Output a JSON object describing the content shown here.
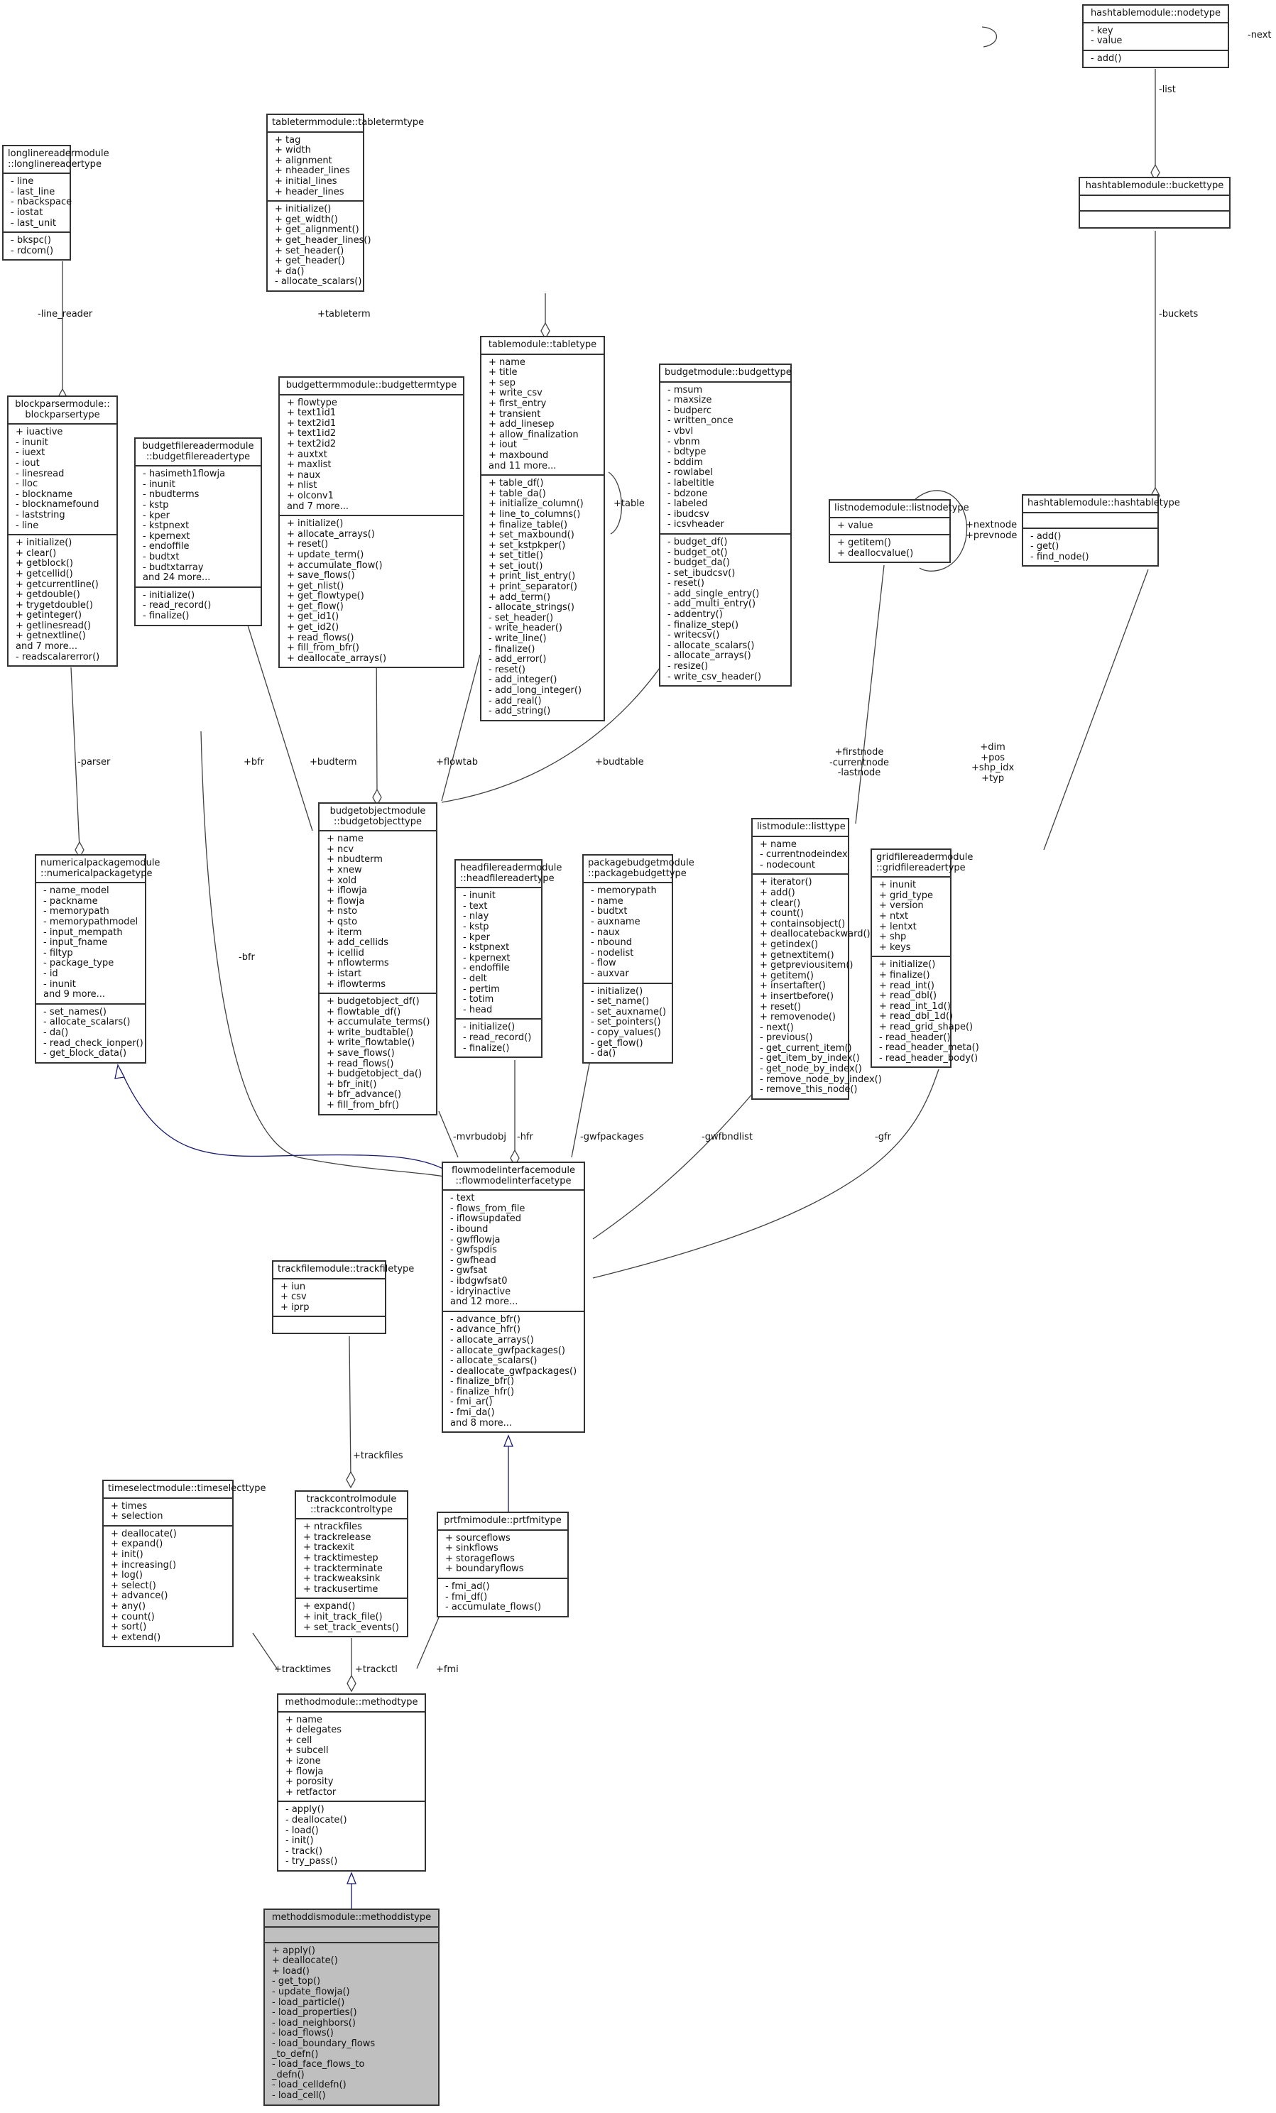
{
  "diagram": {
    "type": "uml-collaboration-graph",
    "focus_class": "methoddismodule::methoddistype",
    "colors": {
      "edge": "#404040",
      "inheritance": "#191970",
      "focus_fill": "#bfbfbf",
      "box_border": "#333333"
    }
  },
  "classes": {
    "nodetype": {
      "title": "hashtablemodule::nodetype",
      "attributes": [
        "- key",
        "- value"
      ],
      "methods": [
        "- add()"
      ]
    },
    "buckettype": {
      "title": "hashtablemodule::buckettype",
      "attributes": [],
      "methods": []
    },
    "hashtabletype": {
      "title": "hashtablemodule::hashtabletype",
      "attributes": [],
      "methods": [
        "- add()",
        "- get()",
        "- find_node()"
      ]
    },
    "longlinereadertype": {
      "title": "longlinereadermodule\n::longlinereadertype",
      "attributes": [
        "- line",
        "- last_line",
        "- nbackspace",
        "- iostat",
        "- last_unit"
      ],
      "methods": [
        "- bkspc()",
        "- rdcom()"
      ]
    },
    "tabletermtype": {
      "title": "tabletermmodule::tabletermtype",
      "attributes": [
        "+ tag",
        "+ width",
        "+ alignment",
        "+ nheader_lines",
        "+ initial_lines",
        "+ header_lines"
      ],
      "methods": [
        "+ initialize()",
        "+ get_width()",
        "+ get_alignment()",
        "+ get_header_lines()",
        "+ set_header()",
        "+ get_header()",
        "+ da()",
        "- allocate_scalars()"
      ]
    },
    "blockparsertype": {
      "title": "blockparsermodule::\nblockparsertype",
      "attributes": [
        "+ iuactive",
        "- inunit",
        "- iuext",
        "- iout",
        "- linesread",
        "- lloc",
        "- blockname",
        "- blocknamefound",
        "- laststring",
        "- line"
      ],
      "methods": [
        "+ initialize()",
        "+ clear()",
        "+ getblock()",
        "+ getcellid()",
        "+ getcurrentline()",
        "+ getdouble()",
        "+ trygetdouble()",
        "+ getinteger()",
        "+ getlinesread()",
        "+ getnextline()",
        "and 7 more...",
        "- readscalarerror()"
      ]
    },
    "budgetfilereadertype": {
      "title": "budgetfilereadermodule\n::budgetfilereadertype",
      "attributes": [
        "- hasimeth1flowja",
        "- inunit",
        "- nbudterms",
        "- kstp",
        "- kper",
        "- kstpnext",
        "- kpernext",
        "- endoffile",
        "- budtxt",
        "- budtxtarray",
        "and 24 more..."
      ],
      "methods": [
        "- initialize()",
        "- read_record()",
        "- finalize()"
      ]
    },
    "budgettermtype": {
      "title": "budgettermmodule::budgettermtype",
      "attributes": [
        "+ flowtype",
        "+ text1id1",
        "+ text2id1",
        "+ text1id2",
        "+ text2id2",
        "+ auxtxt",
        "+ maxlist",
        "+ naux",
        "+ nlist",
        "+ olconv1",
        "and 7 more..."
      ],
      "methods": [
        "+ initialize()",
        "+ allocate_arrays()",
        "+ reset()",
        "+ update_term()",
        "+ accumulate_flow()",
        "+ save_flows()",
        "+ get_nlist()",
        "+ get_flowtype()",
        "+ get_flow()",
        "+ get_id1()",
        "+ get_id2()",
        "+ read_flows()",
        "+ fill_from_bfr()",
        "+ deallocate_arrays()"
      ]
    },
    "tabletype": {
      "title": "tablemodule::tabletype",
      "attributes": [
        "+ name",
        "+ title",
        "+ sep",
        "+ write_csv",
        "+ first_entry",
        "+ transient",
        "+ add_linesep",
        "+ allow_finalization",
        "+ iout",
        "+ maxbound",
        "and 11 more..."
      ],
      "methods": [
        "+ table_df()",
        "+ table_da()",
        "+ initialize_column()",
        "+ line_to_columns()",
        "+ finalize_table()",
        "+ set_maxbound()",
        "+ set_kstpkper()",
        "+ set_title()",
        "+ set_iout()",
        "+ print_list_entry()",
        "+ print_separator()",
        "+ add_term()",
        "- allocate_strings()",
        "- set_header()",
        "- write_header()",
        "- write_line()",
        "- finalize()",
        "- add_error()",
        "- reset()",
        "- add_integer()",
        "- add_long_integer()",
        "- add_real()",
        "- add_string()"
      ]
    },
    "budgettype": {
      "title": "budgetmodule::budgettype",
      "attributes": [
        "- msum",
        "- maxsize",
        "- budperc",
        "- written_once",
        "- vbvl",
        "- vbnm",
        "- bdtype",
        "- bddim",
        "- rowlabel",
        "- labeltitle",
        "- bdzone",
        "- labeled",
        "- ibudcsv",
        "- icsvheader"
      ],
      "methods": [
        "- budget_df()",
        "- budget_ot()",
        "- budget_da()",
        "- set_ibudcsv()",
        "- reset()",
        "- add_single_entry()",
        "- add_multi_entry()",
        "- addentry()",
        "- finalize_step()",
        "- writecsv()",
        "- allocate_scalars()",
        "- allocate_arrays()",
        "- resize()",
        "- write_csv_header()"
      ]
    },
    "listnodetype": {
      "title": "listnodemodule::listnodetype",
      "attributes": [
        "+ value"
      ],
      "methods": [
        "+ getitem()",
        "+ deallocvalue()"
      ]
    },
    "numericalpackagetype": {
      "title": "numericalpackagemodule\n::numericalpackagetype",
      "attributes": [
        "- name_model",
        "- packname",
        "- memorypath",
        "- memorypathmodel",
        "- input_mempath",
        "- input_fname",
        "- filtyp",
        "- package_type",
        "- id",
        "- inunit",
        "and 9 more..."
      ],
      "methods": [
        "- set_names()",
        "- allocate_scalars()",
        "- da()",
        "- read_check_ionper()",
        "- get_block_data()"
      ]
    },
    "budgetobjecttype": {
      "title": "budgetobjectmodule\n::budgetobjecttype",
      "attributes": [
        "+ name",
        "+ ncv",
        "+ nbudterm",
        "+ xnew",
        "+ xold",
        "+ iflowja",
        "+ flowja",
        "+ nsto",
        "+ qsto",
        "+ iterm",
        "+ add_cellids",
        "+ icellid",
        "+ nflowterms",
        "+ istart",
        "+ iflowterms"
      ],
      "methods": [
        "+ budgetobject_df()",
        "+ flowtable_df()",
        "+ accumulate_terms()",
        "+ write_budtable()",
        "+ write_flowtable()",
        "+ save_flows()",
        "+ read_flows()",
        "+ budgetobject_da()",
        "+ bfr_init()",
        "+ bfr_advance()",
        "+ fill_from_bfr()"
      ]
    },
    "headfilereadertype": {
      "title": "headfilereadermodule\n::headfilereadertype",
      "attributes": [
        "- inunit",
        "- text",
        "- nlay",
        "- kstp",
        "- kper",
        "- kstpnext",
        "- kpernext",
        "- endoffile",
        "- delt",
        "- pertim",
        "- totim",
        "- head"
      ],
      "methods": [
        "- initialize()",
        "- read_record()",
        "- finalize()"
      ]
    },
    "packagebudgettype": {
      "title": "packagebudgetmodule\n::packagebudgettype",
      "attributes": [
        "- memorypath",
        "- name",
        "- budtxt",
        "- auxname",
        "- naux",
        "- nbound",
        "- nodelist",
        "- flow",
        "- auxvar"
      ],
      "methods": [
        "- initialize()",
        "- set_name()",
        "- set_auxname()",
        "- set_pointers()",
        "- copy_values()",
        "- get_flow()",
        "- da()"
      ]
    },
    "listtype": {
      "title": "listmodule::listtype",
      "attributes": [
        "+ name",
        "- currentnodeindex",
        "- nodecount"
      ],
      "methods": [
        "+ iterator()",
        "+ add()",
        "+ clear()",
        "+ count()",
        "+ containsobject()",
        "+ deallocatebackward()",
        "+ getindex()",
        "+ getnextitem()",
        "+ getpreviousitem()",
        "+ getitem()",
        "+ insertafter()",
        "+ insertbefore()",
        "+ reset()",
        "+ removenode()",
        "- next()",
        "- previous()",
        "- get_current_item()",
        "- get_item_by_index()",
        "- get_node_by_index()",
        "- remove_node_by_index()",
        "- remove_this_node()"
      ]
    },
    "gridfilereadertype": {
      "title": "gridfilereadermodule\n::gridfilereadertype",
      "attributes": [
        "+ inunit",
        "+ grid_type",
        "+ version",
        "+ ntxt",
        "+ lentxt",
        "+ shp",
        "+ keys"
      ],
      "methods": [
        "+ initialize()",
        "+ finalize()",
        "+ read_int()",
        "+ read_dbl()",
        "+ read_int_1d()",
        "+ read_dbl_1d()",
        "+ read_grid_shape()",
        "- read_header()",
        "- read_header_meta()",
        "- read_header_body()"
      ]
    },
    "flowmodelinterfacetype": {
      "title": "flowmodelinterfacemodule\n::flowmodelinterfacetype",
      "attributes": [
        "- text",
        "- flows_from_file",
        "- iflowsupdated",
        "- ibound",
        "- gwfflowja",
        "- gwfspdis",
        "- gwfhead",
        "- gwfsat",
        "- ibdgwfsat0",
        "- idryinactive",
        "and 12 more..."
      ],
      "methods": [
        "- advance_bfr()",
        "- advance_hfr()",
        "- allocate_arrays()",
        "- allocate_gwfpackages()",
        "- allocate_scalars()",
        "- deallocate_gwfpackages()",
        "- finalize_bfr()",
        "- finalize_hfr()",
        "- fmi_ar()",
        "- fmi_da()",
        "and 8 more..."
      ]
    },
    "trackfiletype": {
      "title": "trackfilemodule::trackfiletype",
      "attributes": [
        "+ iun",
        "+ csv",
        "+ iprp"
      ],
      "methods": []
    },
    "timeselecttype": {
      "title": "timeselectmodule::timeselecttype",
      "attributes": [
        "+ times",
        "+ selection"
      ],
      "methods": [
        "+ deallocate()",
        "+ expand()",
        "+ init()",
        "+ increasing()",
        "+ log()",
        "+ select()",
        "+ advance()",
        "+ any()",
        "+ count()",
        "+ sort()",
        "+ extend()"
      ]
    },
    "trackcontroltype": {
      "title": "trackcontrolmodule\n::trackcontroltype",
      "attributes": [
        "+ ntrackfiles",
        "+ trackrelease",
        "+ trackexit",
        "+ tracktimestep",
        "+ trackterminate",
        "+ trackweaksink",
        "+ trackusertime"
      ],
      "methods": [
        "+ expand()",
        "+ init_track_file()",
        "+ set_track_events()"
      ]
    },
    "prtfmitype": {
      "title": "prtfmimodule::prtfmitype",
      "attributes": [
        "+ sourceflows",
        "+ sinkflows",
        "+ storageflows",
        "+ boundaryflows"
      ],
      "methods": [
        "- fmi_ad()",
        "- fmi_df()",
        "- accumulate_flows()"
      ]
    },
    "methodtype": {
      "title": "methodmodule::methodtype",
      "attributes": [
        "+ name",
        "+ delegates",
        "+ cell",
        "+ subcell",
        "+ izone",
        "+ flowja",
        "+ porosity",
        "+ retfactor"
      ],
      "methods": [
        "- apply()",
        "- deallocate()",
        "- load()",
        "- init()",
        "- track()",
        "- try_pass()"
      ]
    },
    "methoddistype": {
      "title": "methoddismodule::methoddistype",
      "attributes": [],
      "methods": [
        "+ apply()",
        "+ deallocate()",
        "+ load()",
        "- get_top()",
        "- update_flowja()",
        "- load_particle()",
        "- load_properties()",
        "- load_neighbors()",
        "- load_flows()",
        "- load_boundary_flows\n_to_defn()",
        "- load_face_flows_to\n_defn()",
        "- load_celldefn()",
        "- load_cell()"
      ]
    }
  },
  "edge_labels": {
    "next": "-next",
    "list": "-list",
    "buckets": "-buckets",
    "line_reader": "-line_reader",
    "tableterm": "+tableterm",
    "table": "+table",
    "nextnode_prevnode": "+nextnode\n+prevnode",
    "parser": "-parser",
    "bfr_budget": "+bfr",
    "budterm": "+budterm",
    "flowtab": "+flowtab",
    "budtable": "+budtable",
    "listnode_refs": "+firstnode\n-currentnode\n-lastnode",
    "grid_refs": "+dim\n+pos\n+shp_idx\n+typ",
    "bfr_fmi": "-bfr",
    "mvrbudobj": "-mvrbudobj",
    "hfr": "-hfr",
    "gwfpackages": "-gwfpackages",
    "gwfbndlist": "-gwfbndlist",
    "gfr": "-gfr",
    "trackfiles": "+trackfiles",
    "tracktimes": "+tracktimes",
    "trackctl": "+trackctl",
    "fmi": "+fmi"
  }
}
